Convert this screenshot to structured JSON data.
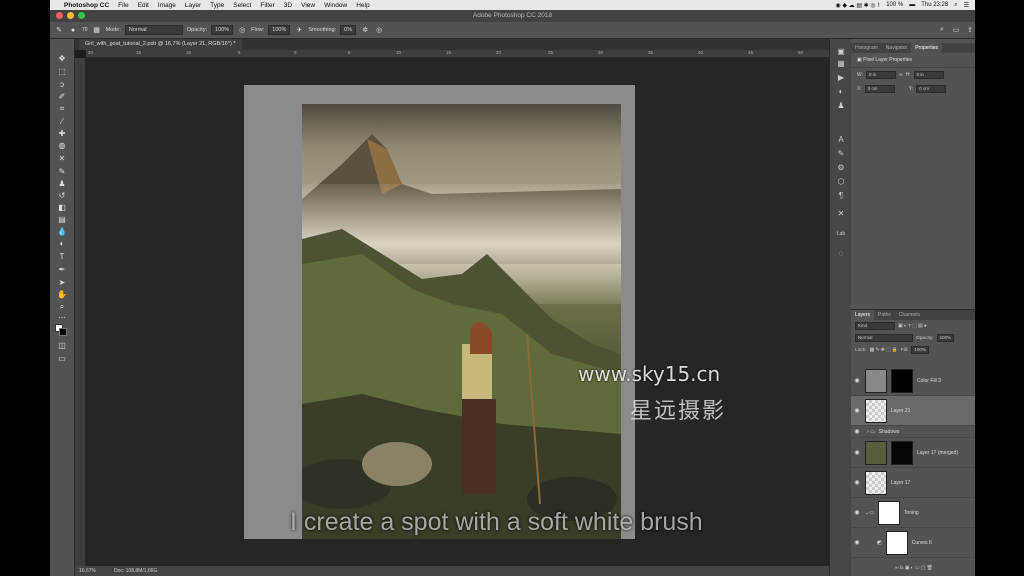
{
  "menubar": {
    "app": "Photoshop CC",
    "items": [
      "File",
      "Edit",
      "Image",
      "Layer",
      "Type",
      "Select",
      "Filter",
      "3D",
      "View",
      "Window",
      "Help"
    ],
    "battery": "100 %",
    "clock": "Thu 23:28"
  },
  "window": {
    "title": "Adobe Photoshop CC 2018"
  },
  "options": {
    "brush_size": "70",
    "mode_label": "Mode:",
    "mode_value": "Normal",
    "opacity_label": "Opacity:",
    "opacity_value": "100%",
    "flow_label": "Flow:",
    "flow_value": "100%",
    "smoothing_label": "Smoothing:",
    "smoothing_value": "0%"
  },
  "document": {
    "tab_title": "Girl_with_goat_tutorial_2.psb @ 16,7% (Layer 21, RGB/16*) *"
  },
  "ruler_ticks": [
    "20",
    "15",
    "10",
    "5",
    "0",
    "5",
    "10",
    "15",
    "20",
    "25",
    "30",
    "35",
    "40",
    "45",
    "50"
  ],
  "status": {
    "zoom": "16,67%",
    "doc": "Doc: 108,8M/1,66G"
  },
  "properties": {
    "tabs": [
      "Histogram",
      "Navigator",
      "Properties"
    ],
    "active_tab": "Properties",
    "title": "Pixel Layer Properties",
    "w_label": "W:",
    "w_value": "0 in",
    "h_label": "H:",
    "h_value": "0 in",
    "x_label": "X:",
    "x_value": "0 cm",
    "y_label": "Y:",
    "y_value": "0 cm"
  },
  "layers_panel": {
    "tabs": [
      "Layers",
      "Paths",
      "Channels"
    ],
    "active_tab": "Layers",
    "kind": "Kind",
    "blend": "Normal",
    "opacity_label": "Opacity:",
    "opacity_value": "100%",
    "lock_label": "Lock:",
    "fill_label": "Fill:",
    "fill_value": "100%",
    "layers": [
      {
        "name": "Color Fill 3"
      },
      {
        "name": "Layer 21"
      },
      {
        "name": "Shadows"
      },
      {
        "name": "Layer 17 (merged)"
      },
      {
        "name": "Layer 17"
      },
      {
        "name": "Toning"
      },
      {
        "name": "Curves 6"
      }
    ]
  },
  "overlay": {
    "watermark": "www.sky15.cn",
    "watermark_cn": "星远摄影",
    "caption": "I create a spot with a soft white brush"
  },
  "colors": {
    "panel": "#535353",
    "canvas_bg": "#262626",
    "pasteboard": "#8b8b8b"
  }
}
